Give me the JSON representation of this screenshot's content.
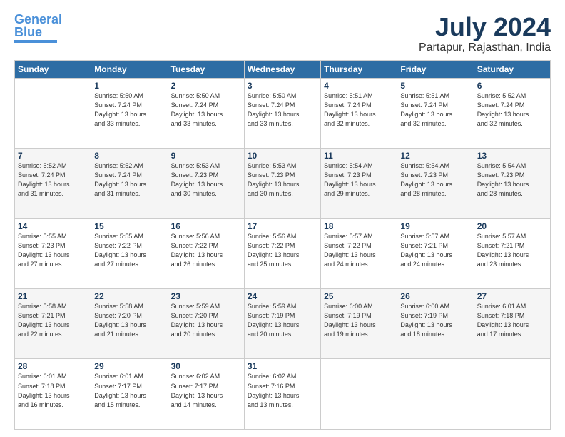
{
  "logo": {
    "text1": "General",
    "text2": "Blue"
  },
  "header": {
    "month_year": "July 2024",
    "location": "Partapur, Rajasthan, India"
  },
  "weekdays": [
    "Sunday",
    "Monday",
    "Tuesday",
    "Wednesday",
    "Thursday",
    "Friday",
    "Saturday"
  ],
  "weeks": [
    [
      {
        "day": "",
        "info": ""
      },
      {
        "day": "1",
        "info": "Sunrise: 5:50 AM\nSunset: 7:24 PM\nDaylight: 13 hours\nand 33 minutes."
      },
      {
        "day": "2",
        "info": "Sunrise: 5:50 AM\nSunset: 7:24 PM\nDaylight: 13 hours\nand 33 minutes."
      },
      {
        "day": "3",
        "info": "Sunrise: 5:50 AM\nSunset: 7:24 PM\nDaylight: 13 hours\nand 33 minutes."
      },
      {
        "day": "4",
        "info": "Sunrise: 5:51 AM\nSunset: 7:24 PM\nDaylight: 13 hours\nand 32 minutes."
      },
      {
        "day": "5",
        "info": "Sunrise: 5:51 AM\nSunset: 7:24 PM\nDaylight: 13 hours\nand 32 minutes."
      },
      {
        "day": "6",
        "info": "Sunrise: 5:52 AM\nSunset: 7:24 PM\nDaylight: 13 hours\nand 32 minutes."
      }
    ],
    [
      {
        "day": "7",
        "info": "Sunrise: 5:52 AM\nSunset: 7:24 PM\nDaylight: 13 hours\nand 31 minutes."
      },
      {
        "day": "8",
        "info": "Sunrise: 5:52 AM\nSunset: 7:24 PM\nDaylight: 13 hours\nand 31 minutes."
      },
      {
        "day": "9",
        "info": "Sunrise: 5:53 AM\nSunset: 7:23 PM\nDaylight: 13 hours\nand 30 minutes."
      },
      {
        "day": "10",
        "info": "Sunrise: 5:53 AM\nSunset: 7:23 PM\nDaylight: 13 hours\nand 30 minutes."
      },
      {
        "day": "11",
        "info": "Sunrise: 5:54 AM\nSunset: 7:23 PM\nDaylight: 13 hours\nand 29 minutes."
      },
      {
        "day": "12",
        "info": "Sunrise: 5:54 AM\nSunset: 7:23 PM\nDaylight: 13 hours\nand 28 minutes."
      },
      {
        "day": "13",
        "info": "Sunrise: 5:54 AM\nSunset: 7:23 PM\nDaylight: 13 hours\nand 28 minutes."
      }
    ],
    [
      {
        "day": "14",
        "info": "Sunrise: 5:55 AM\nSunset: 7:23 PM\nDaylight: 13 hours\nand 27 minutes."
      },
      {
        "day": "15",
        "info": "Sunrise: 5:55 AM\nSunset: 7:22 PM\nDaylight: 13 hours\nand 27 minutes."
      },
      {
        "day": "16",
        "info": "Sunrise: 5:56 AM\nSunset: 7:22 PM\nDaylight: 13 hours\nand 26 minutes."
      },
      {
        "day": "17",
        "info": "Sunrise: 5:56 AM\nSunset: 7:22 PM\nDaylight: 13 hours\nand 25 minutes."
      },
      {
        "day": "18",
        "info": "Sunrise: 5:57 AM\nSunset: 7:22 PM\nDaylight: 13 hours\nand 24 minutes."
      },
      {
        "day": "19",
        "info": "Sunrise: 5:57 AM\nSunset: 7:21 PM\nDaylight: 13 hours\nand 24 minutes."
      },
      {
        "day": "20",
        "info": "Sunrise: 5:57 AM\nSunset: 7:21 PM\nDaylight: 13 hours\nand 23 minutes."
      }
    ],
    [
      {
        "day": "21",
        "info": "Sunrise: 5:58 AM\nSunset: 7:21 PM\nDaylight: 13 hours\nand 22 minutes."
      },
      {
        "day": "22",
        "info": "Sunrise: 5:58 AM\nSunset: 7:20 PM\nDaylight: 13 hours\nand 21 minutes."
      },
      {
        "day": "23",
        "info": "Sunrise: 5:59 AM\nSunset: 7:20 PM\nDaylight: 13 hours\nand 20 minutes."
      },
      {
        "day": "24",
        "info": "Sunrise: 5:59 AM\nSunset: 7:19 PM\nDaylight: 13 hours\nand 20 minutes."
      },
      {
        "day": "25",
        "info": "Sunrise: 6:00 AM\nSunset: 7:19 PM\nDaylight: 13 hours\nand 19 minutes."
      },
      {
        "day": "26",
        "info": "Sunrise: 6:00 AM\nSunset: 7:19 PM\nDaylight: 13 hours\nand 18 minutes."
      },
      {
        "day": "27",
        "info": "Sunrise: 6:01 AM\nSunset: 7:18 PM\nDaylight: 13 hours\nand 17 minutes."
      }
    ],
    [
      {
        "day": "28",
        "info": "Sunrise: 6:01 AM\nSunset: 7:18 PM\nDaylight: 13 hours\nand 16 minutes."
      },
      {
        "day": "29",
        "info": "Sunrise: 6:01 AM\nSunset: 7:17 PM\nDaylight: 13 hours\nand 15 minutes."
      },
      {
        "day": "30",
        "info": "Sunrise: 6:02 AM\nSunset: 7:17 PM\nDaylight: 13 hours\nand 14 minutes."
      },
      {
        "day": "31",
        "info": "Sunrise: 6:02 AM\nSunset: 7:16 PM\nDaylight: 13 hours\nand 13 minutes."
      },
      {
        "day": "",
        "info": ""
      },
      {
        "day": "",
        "info": ""
      },
      {
        "day": "",
        "info": ""
      }
    ]
  ]
}
